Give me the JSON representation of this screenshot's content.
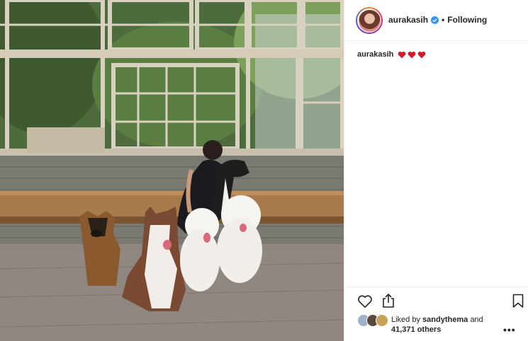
{
  "post": {
    "username": "aurakasih",
    "follow_status": "Following",
    "separator": "•",
    "caption_user": "aurakasih",
    "caption_hearts": [
      "heart",
      "heart",
      "heart"
    ],
    "liked_by_prefix": "Liked by",
    "liked_by_user": "sandythema",
    "liked_by_and": "and",
    "others_count": "41,371 others",
    "more_label": "•••"
  },
  "icons": {
    "verified": "verified-badge-icon",
    "like": "heart-outline-icon",
    "share": "share-icon",
    "save": "bookmark-icon",
    "more": "ellipsis-icon"
  },
  "colors": {
    "verified": "#3897f0",
    "heart_emoji": "#d11a2a",
    "border": "#efefef",
    "text": "#262626"
  }
}
